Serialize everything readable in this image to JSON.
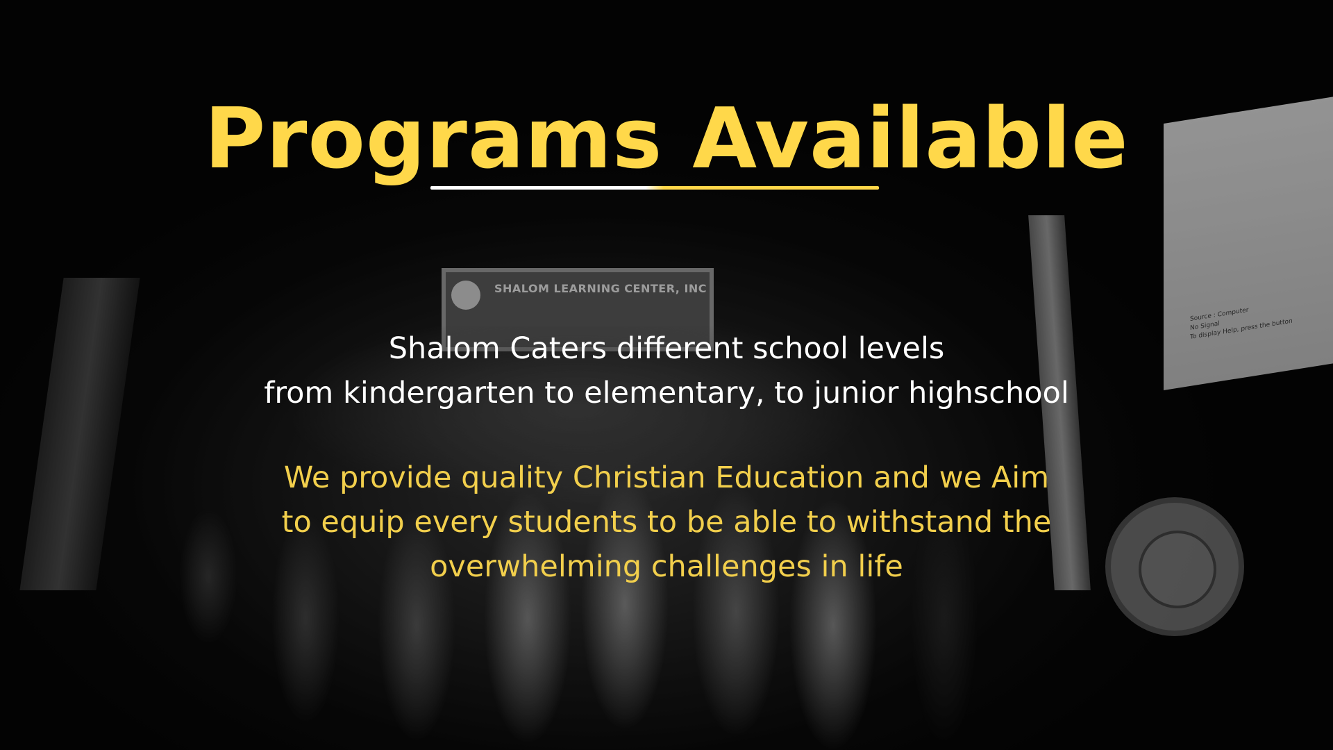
{
  "slide": {
    "title": "Programs Available",
    "levels_text": [
      "Shalom Caters different school levels",
      "from kindergarten to elementary, to junior highschool"
    ],
    "mission_text": [
      "We provide quality Christian Education and we Aim",
      "to equip every students to be able to withstand the",
      "overwhelming challenges in life"
    ]
  },
  "photo": {
    "banner_text": "SHALOM LEARNING CENTER, INC",
    "screen_text": [
      "Source : Computer",
      "No Signal",
      "To display Help, press the button"
    ]
  },
  "colors": {
    "title": "#ffd84a",
    "body": "#ffffff",
    "accent_text": "#f2cf4c",
    "background": "#000000"
  }
}
